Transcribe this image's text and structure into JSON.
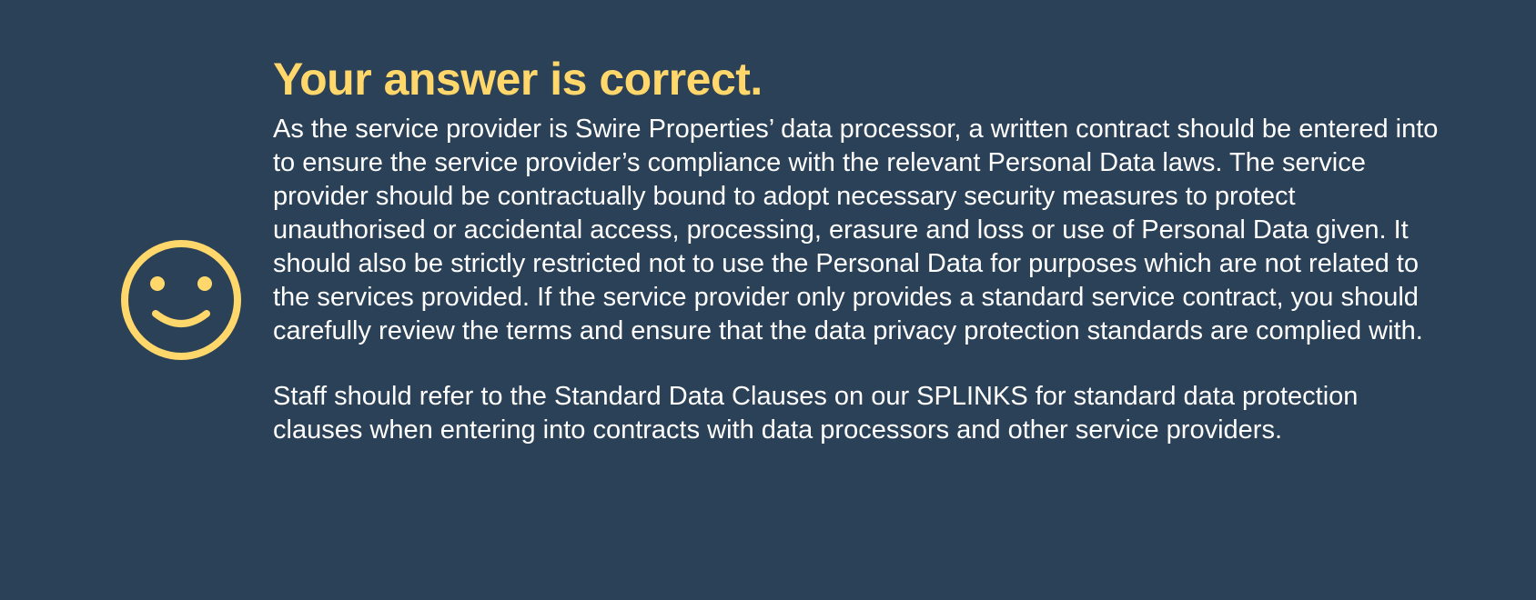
{
  "feedback": {
    "icon": "smiley-face-icon",
    "accent_color": "#ffd76a",
    "background_color": "#2a4157",
    "title": "Your answer is correct.",
    "paragraphs": [
      "As the service provider is Swire Properties’ data processor, a written contract should be entered into to ensure the service provider’s compliance with the relevant Personal Data laws.  The service provider should be contractually bound to adopt necessary security measures to protect unauthorised or accidental access, processing, erasure and loss or use of Personal Data given. It should also be strictly restricted not to use the Personal Data for purposes which are not related to the services provided. If the service provider only provides a standard service contract, you should carefully review the terms and ensure that the data privacy protection standards are complied with.",
      "Staff should refer to the Standard Data Clauses on our SPLINKS for standard data protection clauses when entering into contracts with data processors and other service providers."
    ]
  }
}
